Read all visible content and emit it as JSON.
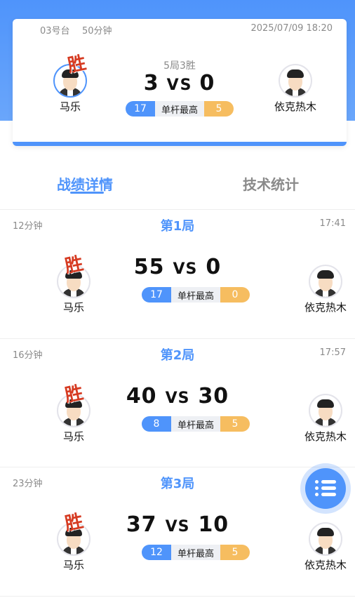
{
  "match": {
    "table": "03号台",
    "duration": "50分钟",
    "datetime": "2025/07/09 18:20",
    "rule": "5局3胜",
    "score_left": "3",
    "vs": "VS",
    "score_right": "0",
    "left_player": "马乐",
    "right_player": "依克热木",
    "win_mark": "胜",
    "highest_break_label": "单杆最高",
    "highest_left": "17",
    "highest_right": "5"
  },
  "tabs": {
    "details": "战绩详情",
    "stats": "技术统计"
  },
  "games": [
    {
      "title": "第1局",
      "duration": "12分钟",
      "time": "17:41",
      "left_score": "55",
      "vs": "VS",
      "right_score": "0",
      "left_player": "马乐",
      "right_player": "依克热木",
      "win_mark": "胜",
      "break_label": "单杆最高",
      "left_break": "17",
      "right_break": "0"
    },
    {
      "title": "第2局",
      "duration": "16分钟",
      "time": "17:57",
      "left_score": "40",
      "vs": "VS",
      "right_score": "30",
      "left_player": "马乐",
      "right_player": "依克热木",
      "win_mark": "胜",
      "break_label": "单杆最高",
      "left_break": "8",
      "right_break": "5"
    },
    {
      "title": "第3局",
      "duration": "23分钟",
      "time": "",
      "left_score": "37",
      "vs": "VS",
      "right_score": "10",
      "left_player": "马乐",
      "right_player": "依克热木",
      "win_mark": "胜",
      "break_label": "单杆最高",
      "left_break": "12",
      "right_break": "5"
    }
  ],
  "colors": {
    "primary": "#4f94fb",
    "accent": "#f6bd60",
    "win_mark": "#d63b22"
  },
  "icons": {
    "fab": "list-menu-icon"
  }
}
